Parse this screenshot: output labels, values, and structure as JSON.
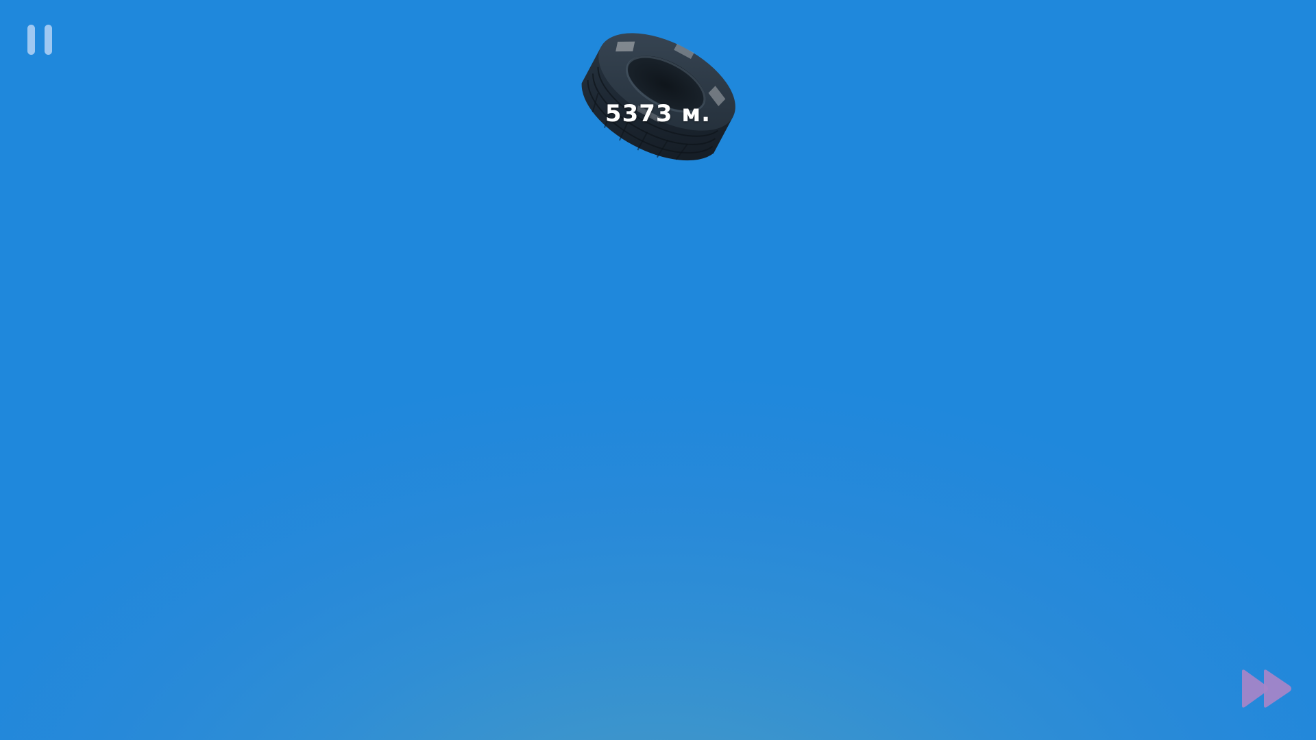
{
  "hud": {
    "distance": "5373 м.",
    "pause_icon": "pause-icon",
    "fast_forward_icon": "fast-forward-icon"
  },
  "colors": {
    "sky_top": "#1f88dc",
    "sky_horizon": "#4b9ac4",
    "pause_icon": "#9ec8f2",
    "fast_forward_icon": "#a884c8",
    "distance_text": "#ffffff",
    "tire": "#1c2630"
  }
}
